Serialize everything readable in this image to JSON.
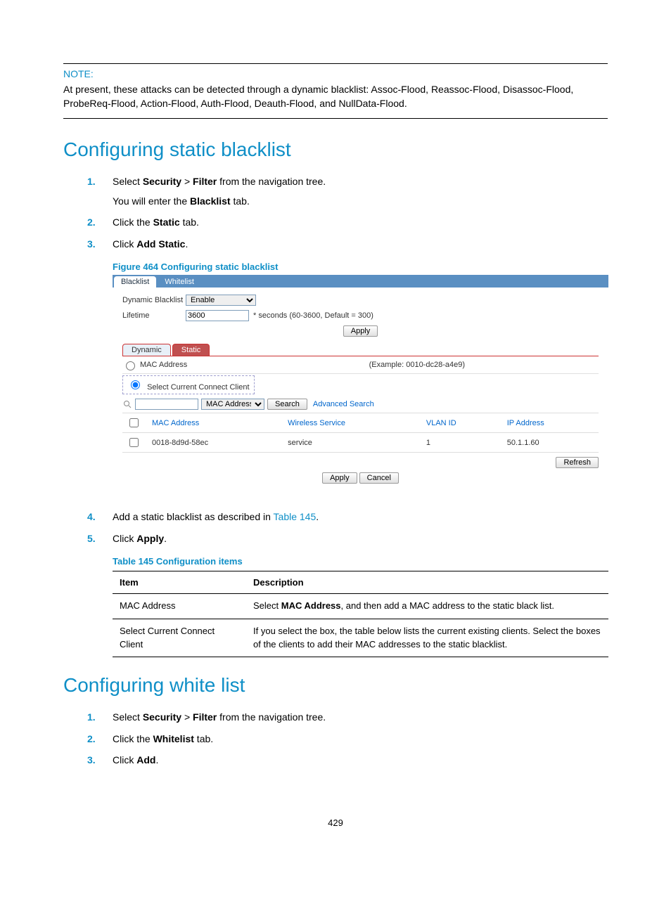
{
  "note": {
    "label": "NOTE:",
    "text": "At present, these attacks can be detected through a dynamic blacklist: Assoc-Flood, Reassoc-Flood, Disassoc-Flood, ProbeReq-Flood, Action-Flood, Auth-Flood, Deauth-Flood, and NullData-Flood."
  },
  "section1": {
    "title": "Configuring static blacklist",
    "steps": [
      {
        "num": "1.",
        "pre": "Select ",
        "b1": "Security",
        "mid": " > ",
        "b2": "Filter",
        "post": " from the navigation tree.",
        "sub": {
          "pre": "You will enter the ",
          "b": "Blacklist",
          "post": " tab."
        }
      },
      {
        "num": "2.",
        "pre": "Click the ",
        "b1": "Static",
        "post": " tab."
      },
      {
        "num": "3.",
        "pre": "Click ",
        "b1": "Add Static",
        "post": "."
      }
    ],
    "figure_title": "Figure 464 Configuring static blacklist",
    "ui": {
      "tabs": {
        "blacklist": "Blacklist",
        "whitelist": "Whitelist"
      },
      "dyn_label": "Dynamic Blacklist",
      "dyn_value": "Enable",
      "lifetime_label": "Lifetime",
      "lifetime_value": "3600",
      "lifetime_hint": "* seconds (60-3600, Default = 300)",
      "apply": "Apply",
      "subtabs": {
        "dynamic": "Dynamic",
        "static": "Static"
      },
      "mac_radio": "MAC Address",
      "mac_example": "(Example: 0010-dc28-a4e9)",
      "sel_client": "Select Current Connect Client",
      "search_field": "MAC Address",
      "search_btn": "Search",
      "adv_search": "Advanced Search",
      "cols": {
        "mac": "MAC Address",
        "ws": "Wireless Service",
        "vlan": "VLAN ID",
        "ip": "IP Address"
      },
      "row": {
        "mac": "0018-8d9d-58ec",
        "ws": "service",
        "vlan": "1",
        "ip": "50.1.1.60"
      },
      "refresh": "Refresh",
      "cancel": "Cancel"
    },
    "steps2": [
      {
        "num": "4.",
        "pre": "Add a static blacklist as described in ",
        "link": "Table 145",
        "post": "."
      },
      {
        "num": "5.",
        "pre": "Click ",
        "b1": "Apply",
        "post": "."
      }
    ],
    "table_title": "Table 145 Configuration items",
    "table": {
      "h1": "Item",
      "h2": "Description",
      "rows": [
        {
          "item": "MAC Address",
          "desc_pre": "Select ",
          "desc_b": "MAC Address",
          "desc_post": ", and then add a MAC address to the static black list."
        },
        {
          "item": "Select Current Connect Client",
          "desc": "If you select the box, the table below lists the current existing clients. Select the boxes of the clients to add their MAC addresses to the static blacklist."
        }
      ]
    }
  },
  "section2": {
    "title": "Configuring white list",
    "steps": [
      {
        "num": "1.",
        "pre": "Select ",
        "b1": "Security",
        "mid": " > ",
        "b2": "Filter",
        "post": " from the navigation tree."
      },
      {
        "num": "2.",
        "pre": "Click the ",
        "b1": "Whitelist",
        "post": " tab."
      },
      {
        "num": "3.",
        "pre": "Click ",
        "b1": "Add",
        "post": "."
      }
    ]
  },
  "page_num": "429"
}
